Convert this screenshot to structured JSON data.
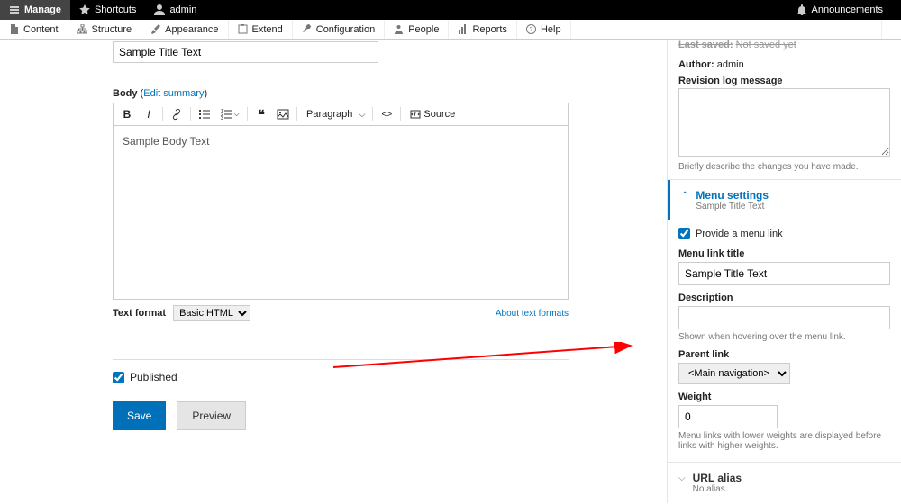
{
  "topbar": {
    "manage": "Manage",
    "shortcuts": "Shortcuts",
    "user": "admin",
    "announcements": "Announcements"
  },
  "toolbar2": {
    "content": "Content",
    "structure": "Structure",
    "appearance": "Appearance",
    "extend": "Extend",
    "configuration": "Configuration",
    "people": "People",
    "reports": "Reports",
    "help": "Help"
  },
  "form": {
    "title_value": "Sample Title Text",
    "body_label": "Body",
    "edit_summary": "Edit summary",
    "paragraph": "Paragraph",
    "source": "Source",
    "body_text": "Sample Body Text",
    "text_format_label": "Text format",
    "text_format_value": "Basic HTML",
    "about_text_formats": "About text formats",
    "published": "Published",
    "save": "Save",
    "preview": "Preview"
  },
  "sidebar": {
    "last_saved_label": "Last saved:",
    "last_saved_value": "Not saved yet",
    "author_label": "Author:",
    "author_value": "admin",
    "revision_label": "Revision log message",
    "revision_help": "Briefly describe the changes you have made.",
    "menu_settings_title": "Menu settings",
    "menu_settings_sub": "Sample Title Text",
    "provide_menu_link": "Provide a menu link",
    "menu_link_title_label": "Menu link title",
    "menu_link_title_value": "Sample Title Text",
    "description_label": "Description",
    "description_help": "Shown when hovering over the menu link.",
    "parent_link_label": "Parent link",
    "parent_link_value": "<Main navigation>",
    "weight_label": "Weight",
    "weight_value": "0",
    "weight_help": "Menu links with lower weights are displayed before links with higher weights.",
    "url_alias_title": "URL alias",
    "url_alias_sub": "No alias"
  }
}
